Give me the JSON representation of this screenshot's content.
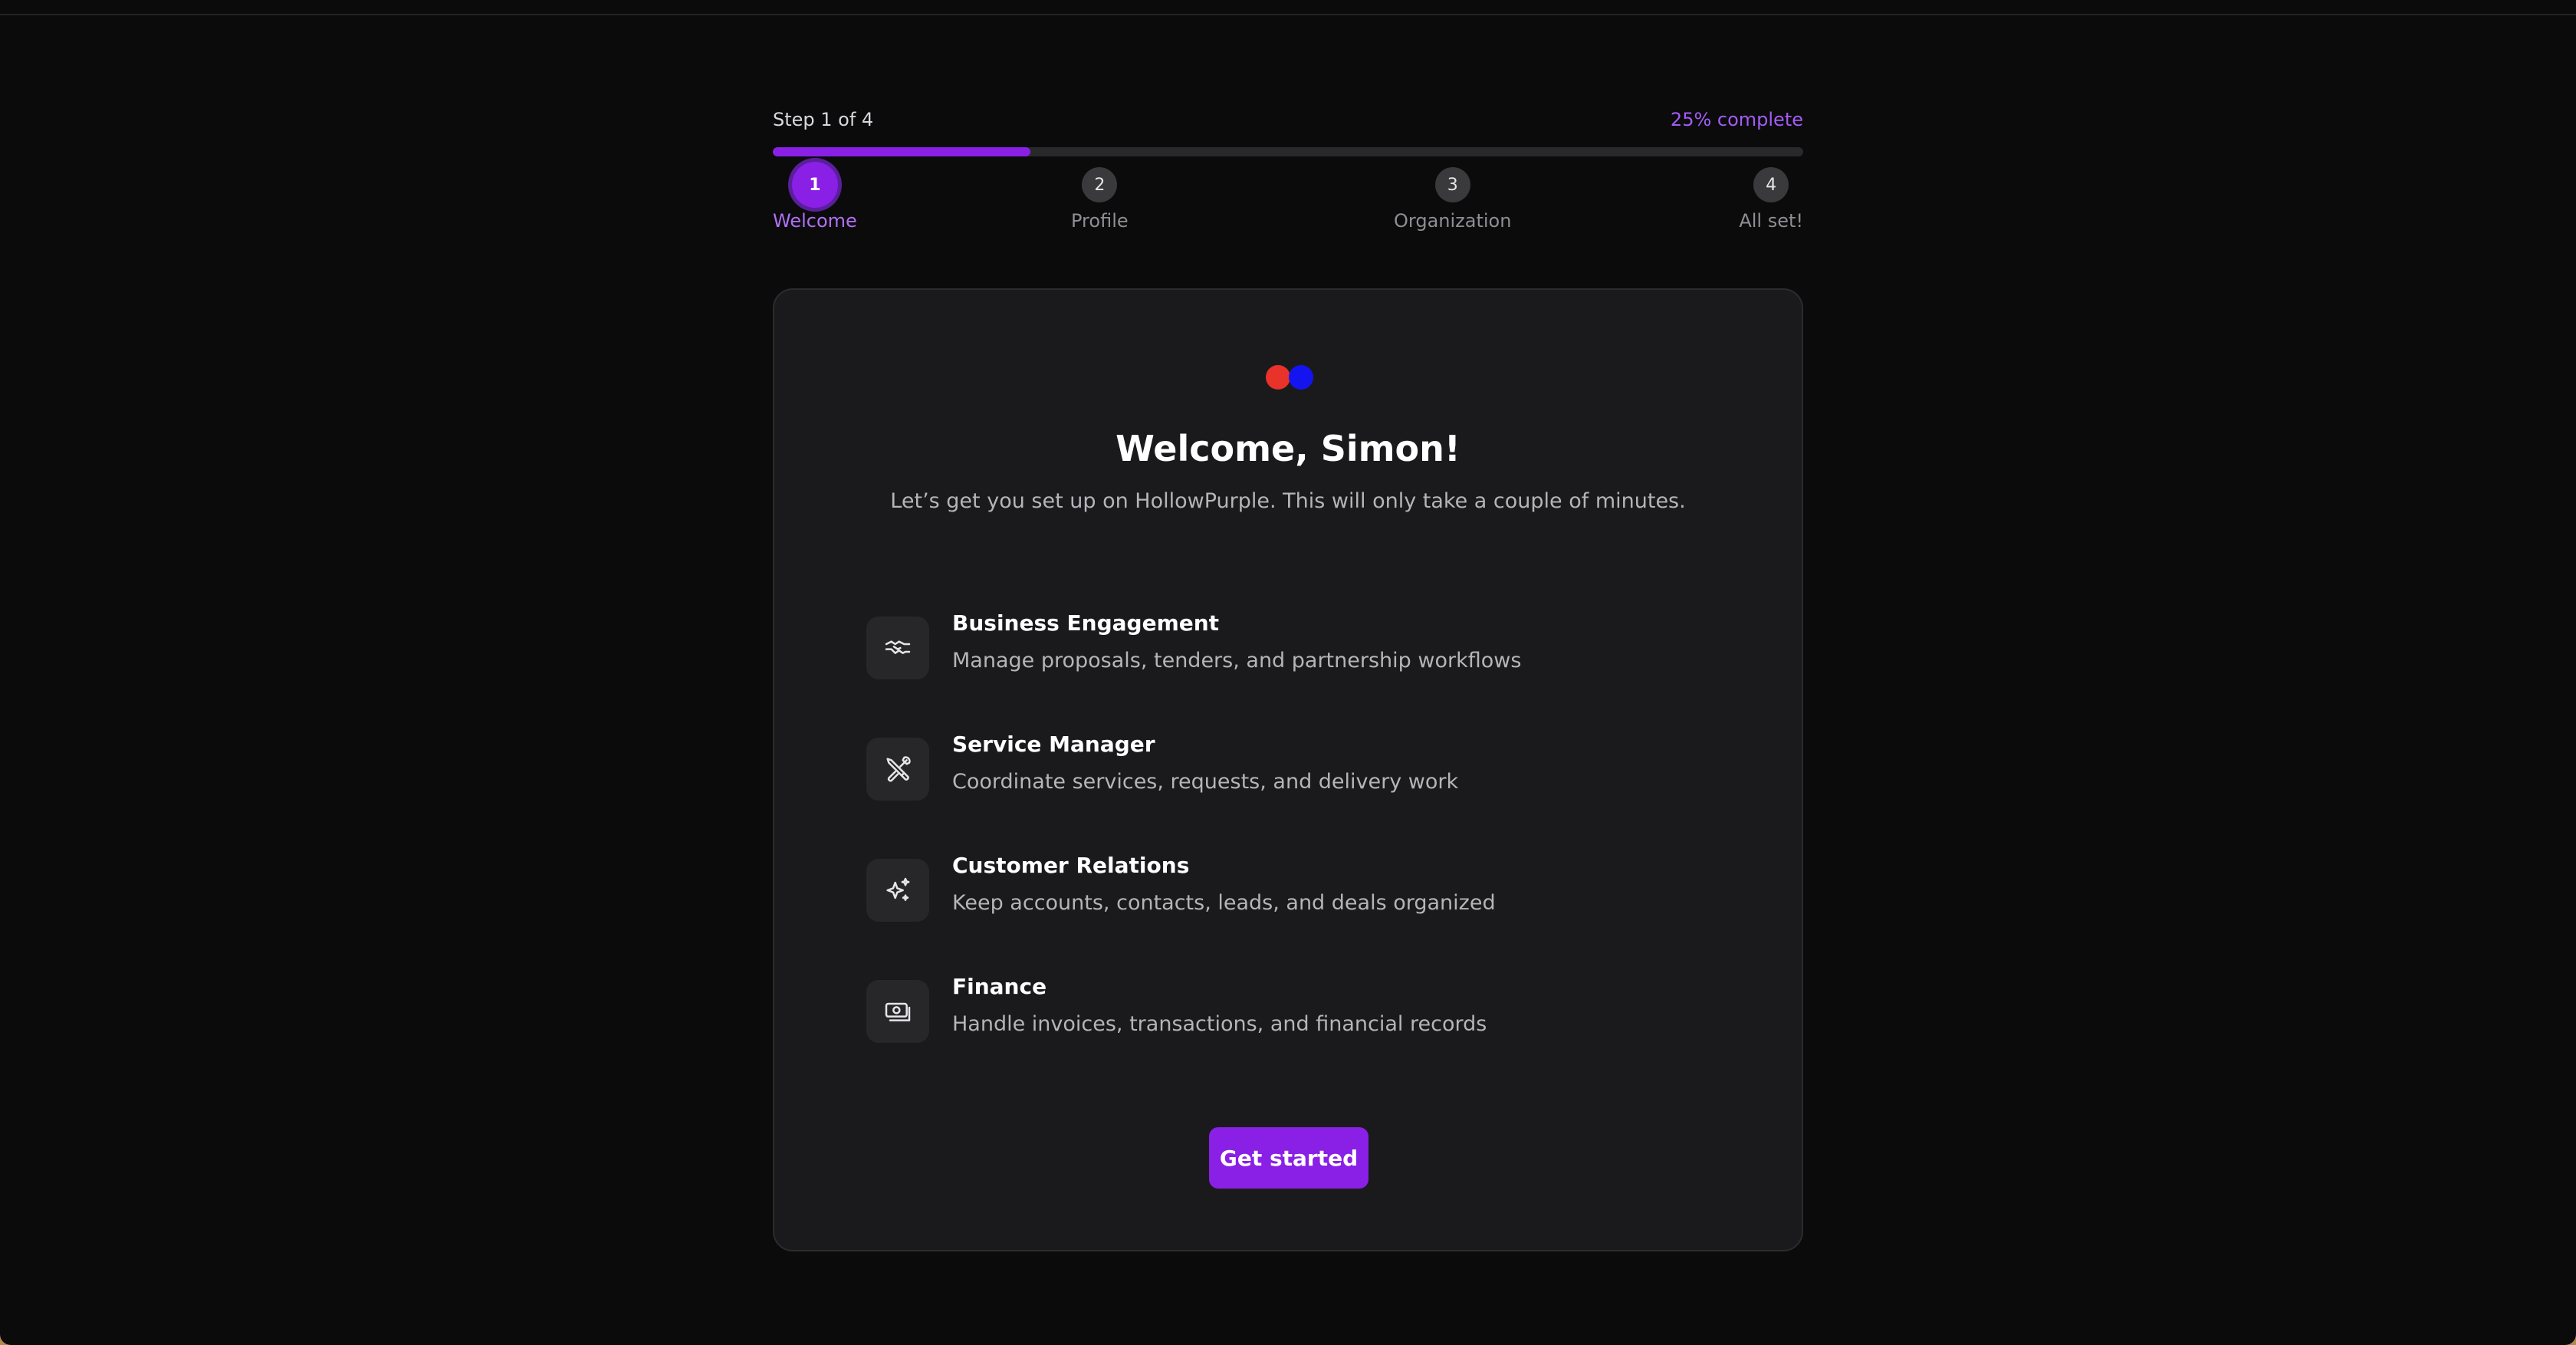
{
  "stepper": {
    "count_text": "Step 1 of 4",
    "percent_text": "25% complete",
    "progress": 0.25,
    "steps": [
      {
        "number": "1",
        "label": "Welcome",
        "active": true
      },
      {
        "number": "2",
        "label": "Profile",
        "active": false
      },
      {
        "number": "3",
        "label": "Organization",
        "active": false
      },
      {
        "number": "4",
        "label": "All set!",
        "active": false
      }
    ]
  },
  "card": {
    "logo": "hollowpurple-logo",
    "title": "Welcome, Simon!",
    "subtitle": "Let’s get you set up on HollowPurple. This will only take a couple of minutes.",
    "features": [
      {
        "icon": "handshake-icon",
        "title": "Business Engagement",
        "description": "Manage proposals, tenders, and partnership workflows"
      },
      {
        "icon": "tools-icon",
        "title": "Service Manager",
        "description": "Coordinate services, requests, and delivery work"
      },
      {
        "icon": "sparkles-icon",
        "title": "Customer Relations",
        "description": "Keep accounts, contacts, leads, and deals organized"
      },
      {
        "icon": "cash-icon",
        "title": "Finance",
        "description": "Handle invoices, transactions, and financial records"
      }
    ],
    "cta_label": "Get started"
  },
  "colors": {
    "accent": "#8a1fe6",
    "accent_text": "#a45cf5",
    "background": "#0b0b0c",
    "card": "#1a1a1c",
    "logo_red": "#e8322a",
    "logo_blue": "#1414f0"
  }
}
